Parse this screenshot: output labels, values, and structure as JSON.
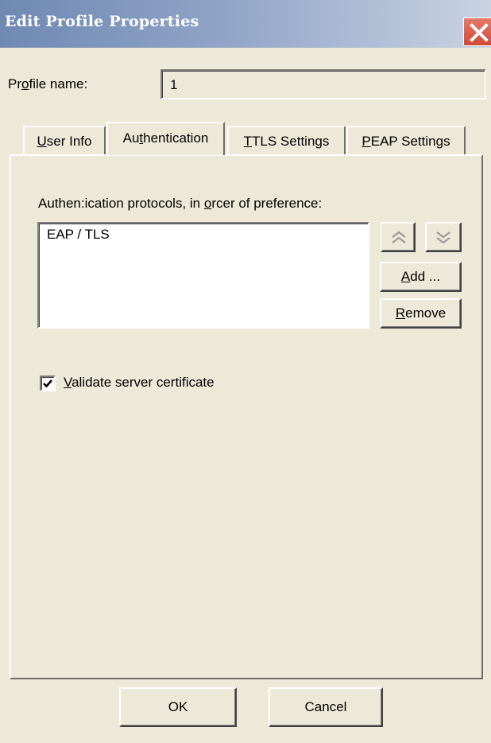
{
  "window": {
    "title": "Edit Profile Properties",
    "close_icon": "close-icon"
  },
  "profile": {
    "label_pre": "Pr",
    "label_key": "o",
    "label_post": "file name:",
    "value": "1"
  },
  "tabs": [
    {
      "pre": "",
      "key": "U",
      "post": "ser Info",
      "active": false
    },
    {
      "pre": "Au",
      "key": "t",
      "post": "hentication",
      "active": true
    },
    {
      "pre": "",
      "key": "T",
      "post": "TLS Settings",
      "active": false
    },
    {
      "pre": "",
      "key": "P",
      "post": "EAP Settings",
      "active": false
    }
  ],
  "authentication": {
    "protocols_label_pre": "Authen:ication protocols, in ",
    "protocols_label_key": "o",
    "protocols_label_post": "rcer of preference:",
    "protocols": [
      "EAP / TLS"
    ],
    "move_up_icon": "double-chevron-up-icon",
    "move_down_icon": "double-chevron-down-icon",
    "add_button": {
      "key": "A",
      "post": "dd ..."
    },
    "remove_button": {
      "key": "R",
      "post": "emove"
    },
    "validate_checkbox": {
      "checked": true,
      "key": "V",
      "post": "alidate server certificate"
    }
  },
  "footer": {
    "ok_label": "OK",
    "cancel_label": "Cancel"
  }
}
